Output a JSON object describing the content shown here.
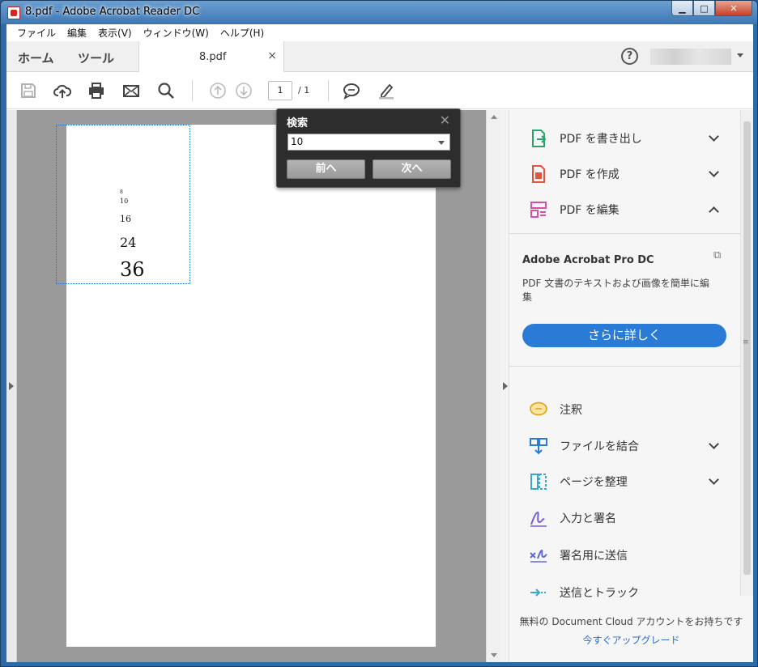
{
  "window": {
    "title": "8.pdf - Adobe Acrobat Reader DC",
    "min": "▁",
    "max": "□",
    "close": "✕"
  },
  "menubar": [
    "ファイル",
    "編集",
    "表示(V)",
    "ウィンドウ(W)",
    "ヘルプ(H)"
  ],
  "tabs": {
    "home": "ホーム",
    "tools": "ツール",
    "doc": "8.pdf",
    "close": "×",
    "help": "?"
  },
  "toolbar": {
    "page_current": "1",
    "page_total": "/ 1"
  },
  "document": {
    "text_lines": [
      "8",
      "10",
      "16",
      "24",
      "36"
    ]
  },
  "find": {
    "title": "検索",
    "close": "✕",
    "query": "10",
    "prev_label": "前へ",
    "next_label": "次へ"
  },
  "right_pane": {
    "tools_top": [
      {
        "label": "PDF を書き出し",
        "icon": "export-pdf-icon",
        "chevron": "down"
      },
      {
        "label": "PDF を作成",
        "icon": "create-pdf-icon",
        "chevron": "down"
      },
      {
        "label": "PDF を編集",
        "icon": "edit-pdf-icon",
        "chevron": "up"
      }
    ],
    "promo": {
      "title": "Adobe Acrobat Pro DC",
      "description": "PDF 文書のテキストおよび画像を簡単に編集",
      "button": "さらに詳しく"
    },
    "tools_bottom": [
      {
        "label": "注釈",
        "icon": "comment-icon"
      },
      {
        "label": "ファイルを結合",
        "icon": "combine-files-icon",
        "chevron": "down"
      },
      {
        "label": "ページを整理",
        "icon": "organize-pages-icon",
        "chevron": "down"
      },
      {
        "label": "入力と署名",
        "icon": "fill-sign-icon"
      },
      {
        "label": "署名用に送信",
        "icon": "send-for-signature-icon"
      },
      {
        "label": "送信とトラック",
        "icon": "send-track-icon"
      }
    ],
    "footer_text": "無料の Document Cloud アカウントをお持ちです",
    "footer_link": "今すぐアップグレード"
  },
  "colors": {
    "accent": "#2a7bd6",
    "find_bg": "#2d2d2d",
    "doc_bg": "#9a9a9a"
  }
}
